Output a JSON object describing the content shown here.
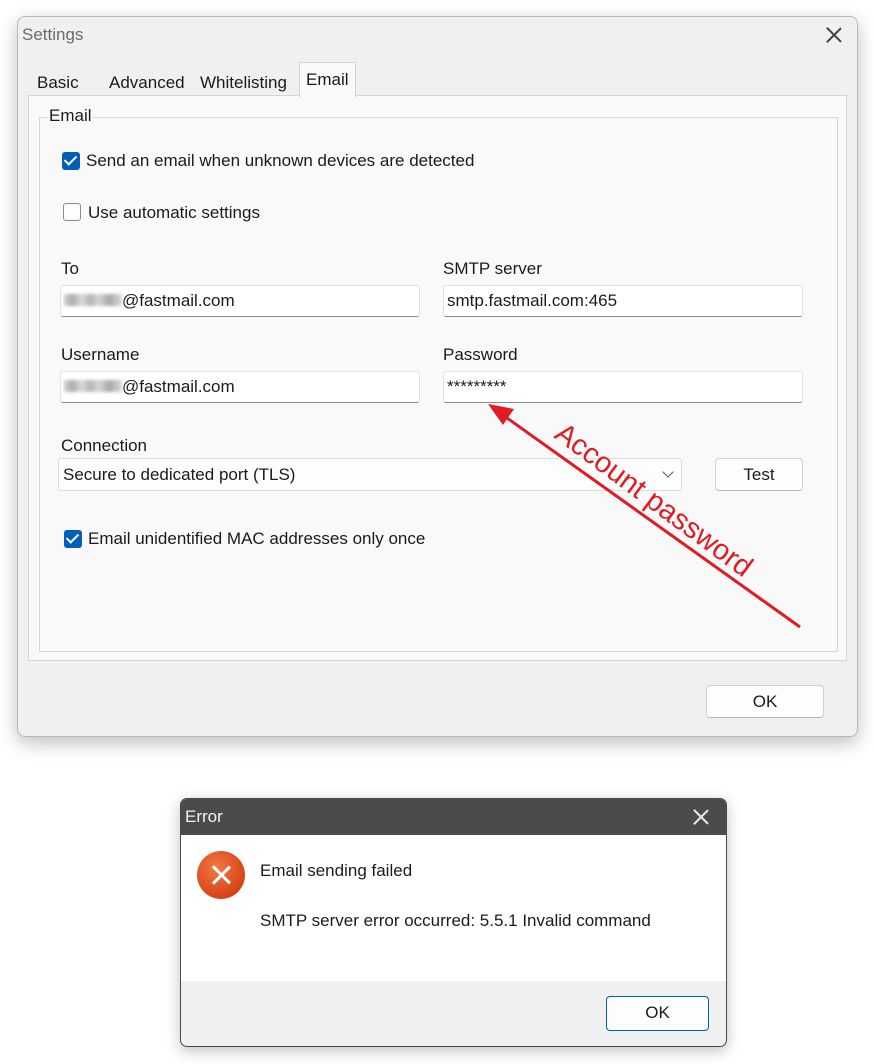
{
  "settings": {
    "title": "Settings",
    "tabs": [
      {
        "label": "Basic",
        "active": false
      },
      {
        "label": "Advanced",
        "active": false
      },
      {
        "label": "Whitelisting",
        "active": false
      },
      {
        "label": "Email",
        "active": true
      }
    ],
    "email_group": {
      "legend": "Email",
      "send_email_checkbox": {
        "label": "Send an email when unknown devices are detected",
        "checked": true
      },
      "auto_settings_checkbox": {
        "label": "Use automatic settings",
        "checked": false
      },
      "to": {
        "label": "To",
        "value_visible": "@fastmail.com"
      },
      "smtp_server": {
        "label": "SMTP server",
        "value": "smtp.fastmail.com:465"
      },
      "username": {
        "label": "Username",
        "value_visible": "@fastmail.com"
      },
      "password": {
        "label": "Password",
        "value": "*********"
      },
      "connection": {
        "label": "Connection",
        "selected": "Secure to dedicated port (TLS)"
      },
      "test_button": "Test",
      "once_checkbox": {
        "label": "Email unidentified MAC addresses only once",
        "checked": true
      }
    },
    "ok_button": "OK",
    "annotation": {
      "text": "Account password",
      "color": "#e01b24"
    }
  },
  "error_dialog": {
    "title": "Error",
    "heading": "Email sending failed",
    "message": "SMTP server error occurred: 5.5.1 Invalid command",
    "icon": "error-icon",
    "ok_button": "OK",
    "accent": "#005fb8"
  }
}
